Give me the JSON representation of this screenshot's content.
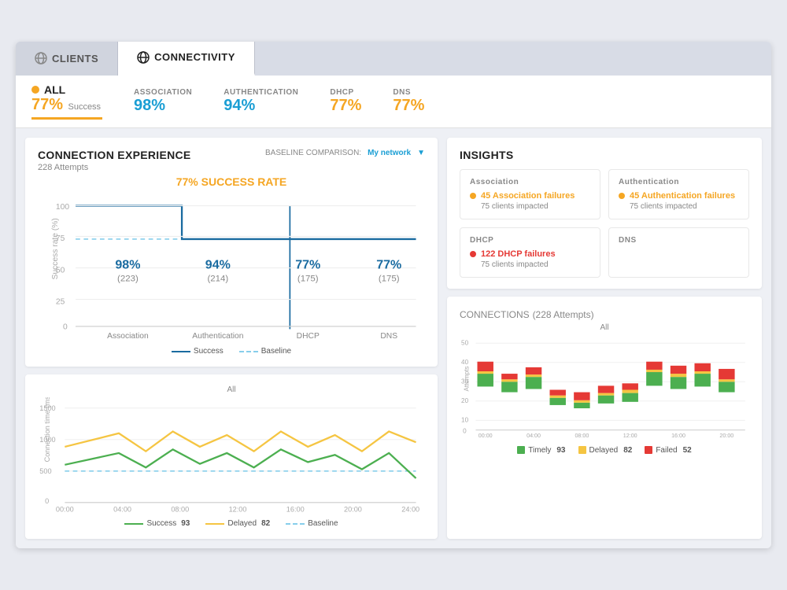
{
  "tabs": [
    {
      "id": "clients",
      "label": "CLIENTS",
      "active": false
    },
    {
      "id": "connectivity",
      "label": "CONNECTIVITY",
      "active": true
    }
  ],
  "metrics": {
    "all": {
      "label": "ALL",
      "value": "77%",
      "success": "Success"
    },
    "items": [
      {
        "label": "ASSOCIATION",
        "value": "98%",
        "warn": false
      },
      {
        "label": "AUTHENTICATION",
        "value": "94%",
        "warn": false
      },
      {
        "label": "DHCP",
        "value": "77%",
        "warn": true
      },
      {
        "label": "DNS",
        "value": "77%",
        "warn": true
      }
    ]
  },
  "connection_experience": {
    "title": "CONNECTION EXPERIENCE",
    "attempts": "228 Attempts",
    "baseline_label": "BASELINE COMPARISON:",
    "network_label": "My network",
    "success_rate_label": "77% SUCCESS RATE",
    "bars": [
      {
        "label": "Association",
        "value": "98%",
        "count": "(223)"
      },
      {
        "label": "Authentication",
        "value": "94%",
        "count": "(214)"
      },
      {
        "label": "DHCP",
        "value": "77%",
        "count": "(175)"
      },
      {
        "label": "DNS",
        "value": "77%",
        "count": "(175)"
      }
    ],
    "legend": {
      "success": "Success",
      "baseline": "Baseline"
    },
    "time_chart": {
      "title": "All",
      "y_label": "Connection time (ms)",
      "x_labels": [
        "00:00",
        "04:00",
        "08:00",
        "12:00",
        "16:00",
        "20:00",
        "24:00"
      ],
      "y_labels": [
        "0",
        "500",
        "1000",
        "1500"
      ],
      "legend": {
        "success": "Success",
        "success_count": "93",
        "delayed": "Delayed",
        "delayed_count": "82",
        "baseline": "Baseline"
      }
    }
  },
  "insights": {
    "title": "INSIGHTS",
    "sections": [
      {
        "category": "Association",
        "failure_text": "45 Association failures",
        "clients_text": "75 clients impacted",
        "color": "orange"
      },
      {
        "category": "Authentication",
        "failure_text": "45 Authentication failures",
        "clients_text": "75 clients impacted",
        "color": "orange"
      },
      {
        "category": "DHCP",
        "failure_text": "122 DHCP failures",
        "clients_text": "75 clients impacted",
        "color": "red"
      },
      {
        "category": "DNS",
        "failure_text": "",
        "clients_text": "",
        "color": "none"
      }
    ]
  },
  "connections": {
    "title": "CONNECTIONS",
    "attempts": "(228 Attempts)",
    "chart_title": "All",
    "x_labels": [
      "00:00",
      "04:00",
      "08:00",
      "12:00",
      "16:00",
      "20:00"
    ],
    "y_labels": [
      "0",
      "10",
      "20",
      "30",
      "40",
      "50"
    ],
    "legend": {
      "timely": "Timely",
      "timely_count": "93",
      "delayed": "Delayed",
      "delayed_count": "82",
      "failed": "Failed",
      "failed_count": "52"
    }
  }
}
